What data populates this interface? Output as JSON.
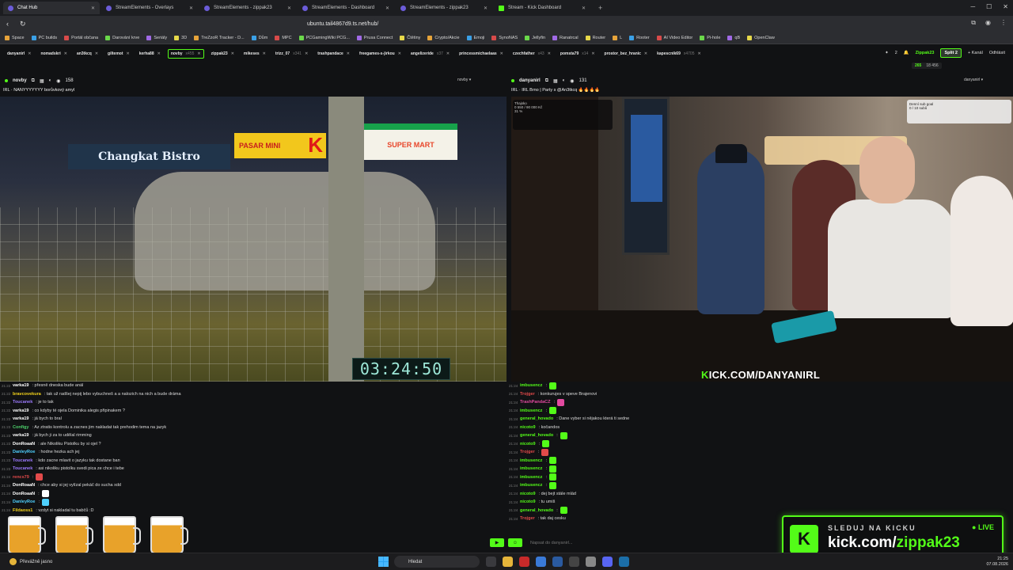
{
  "browser": {
    "tabs": [
      {
        "label": "Chat Hub",
        "active": true
      },
      {
        "label": "StreamElements - Overlays"
      },
      {
        "label": "StreamElements - zippak23"
      },
      {
        "label": "StreamElements - Dashboard"
      },
      {
        "label": "StreamElements - zippak23"
      },
      {
        "label": "Stream - Kick Dashboard",
        "kick": true
      }
    ],
    "url": "ubuntu.tail4867d9.ts.net/hub/"
  },
  "bookmarks": [
    "Space",
    "PC builds",
    "Portál občana",
    "Darování krve",
    "Seriály",
    "3D",
    "TreZzoR Tracker - D...",
    "Dům",
    "MPC",
    "PCGamingWiki PCG...",
    "Prusa Connect",
    "Čtětiny",
    "Crypto/Akcie",
    "Emoji",
    "SynoNAS",
    "Jellyfin",
    "Ranatrcal",
    "Router",
    "L",
    "Rooter",
    "AI Video Editor",
    "Pi-hole",
    "qB",
    "OpenClaw"
  ],
  "channel_tabs": [
    {
      "name": "danyanirl"
    },
    {
      "name": "nomadskri"
    },
    {
      "name": "an3tkcq"
    },
    {
      "name": "giltemot"
    },
    {
      "name": "kerha88"
    },
    {
      "name": "novby",
      "cnt": "x455",
      "selected": true
    },
    {
      "name": "zippak23"
    },
    {
      "name": "mikeses"
    },
    {
      "name": "trizz_07",
      "cnt": "x341"
    },
    {
      "name": "trashpandace"
    },
    {
      "name": "freegames-s-jirkou"
    },
    {
      "name": "angelizeride",
      "cnt": "x37"
    },
    {
      "name": "princessmichaelaas"
    },
    {
      "name": "czechfather",
      "cnt": "x43"
    },
    {
      "name": "pomsta79",
      "cnt": "x14"
    },
    {
      "name": "prostor_bez_hranic"
    },
    {
      "name": "kapescnik69",
      "cnt": "x4705"
    }
  ],
  "toolbar": {
    "count": "2",
    "zippak": "Zippak23",
    "split": "Split 2",
    "kanal": "+ Kanál",
    "odhlasit": "Odhlásit"
  },
  "viewers_bar": {
    "a": "265",
    "b": "18 456"
  },
  "left_panel": {
    "channel": "novby",
    "viewers": "158",
    "selector": "novby",
    "title": "IRL · NANYYYYYYY borůvkový amyl",
    "timer": "03:24:50",
    "signs": {
      "bistro": "Changkat Bistro",
      "pasar": "PASAR MINI",
      "k": "K",
      "supermart": "SUPER MART"
    }
  },
  "right_panel": {
    "channel": "danyanirl",
    "viewers": "131",
    "selector": "danyanirl",
    "title": "IRL · IRL Brno | Party s @An3tkcq 🔥🔥🔥🔥",
    "brand_k": "K",
    "brand_rest": "ICK.COM/DANYANIRL",
    "overlay1": {
      "a": "Thajsko",
      "b": "0 550 / 90 000 Kč",
      "c": "31 %"
    },
    "overlay2": {
      "a": "Denní sub goal",
      "b": "0 / 10 subů"
    }
  },
  "chat_left": [
    {
      "ts": "21:22",
      "user": "varka19",
      "color": "#ffffff",
      "text": ": přesně dneska bude anál"
    },
    {
      "ts": "21:22",
      "user": "bravcovekura",
      "color": "#f2d21b",
      "text": ": tak už radšej nepij lebo vybuchneš a a nalozich na nich a bude dráma"
    },
    {
      "ts": "21:22",
      "user": "Toucanek",
      "color": "#9d7bff",
      "text": ": je to tak"
    },
    {
      "ts": "21:22",
      "user": "varka19",
      "color": "#ffffff",
      "text": ": co kdyby té ojela Dominika alegis připinakem ?"
    },
    {
      "ts": "21:23",
      "user": "varka19",
      "color": "#ffffff",
      "text": ": já bych to bral"
    },
    {
      "ts": "21:23",
      "user": "Configy",
      "color": "#4dd06b",
      "text": ": Az ztratis kontrolu a zacnes jim nakladat tak prehodim tema na jazyk"
    },
    {
      "ts": "21:23",
      "user": "varka19",
      "color": "#ffffff",
      "text": ": já bych ji za to udělal rimming"
    },
    {
      "ts": "21:23",
      "user": "DonRoaaN",
      "color": "#ffffff",
      "text": ": ale Nikoliku Pistolku by si ojel ?"
    },
    {
      "ts": "21:23",
      "user": "DanleyRoe",
      "color": "#4fd1ff",
      "text": ": hodne hezka ach jej"
    },
    {
      "ts": "21:23",
      "user": "Toucanek",
      "color": "#9d7bff",
      "text": ": kdo zacne mlavit o jazyku tak dostane ban"
    },
    {
      "ts": "21:23",
      "user": "Toucanek",
      "color": "#9d7bff",
      "text": ": asi nikoliku pistolku svedi pica ze chce i tebe"
    },
    {
      "ts": "21:24",
      "user": "rencs79",
      "color": "#e24a4a",
      "text": ":"
    },
    {
      "ts": "21:24",
      "user": "DonRoaaN",
      "color": "#ffffff",
      "text": ": chce aby si jej vylízal pekáč do sucha xdd"
    },
    {
      "ts": "21:24",
      "user": "DonRoaaN",
      "color": "#ffffff",
      "text": ":"
    },
    {
      "ts": "21:24",
      "user": "DanleyRoe",
      "color": "#4fd1ff",
      "text": ":"
    },
    {
      "ts": "21:24",
      "user": "Fildaoss1",
      "color": "#f2d21b",
      "text": ": vzdyt si nakladal tu babčů :D"
    }
  ],
  "chat_right": [
    {
      "ts": "21:24",
      "user": "imbusencz",
      "color": "#53fc18",
      "text": ":"
    },
    {
      "ts": "21:24",
      "user": "Trojger",
      "color": "#e24a4a",
      "text": ": konkurujes v speve Brajenovi"
    },
    {
      "ts": "21:24",
      "user": "TrashPandaCZ",
      "color": "#e24aa0",
      "text": ":"
    },
    {
      "ts": "21:24",
      "user": "imbusencz",
      "color": "#53fc18",
      "text": ":"
    },
    {
      "ts": "21:24",
      "user": "general_hovado",
      "color": "#53fc18",
      "text": ": Dane vyber si nějakou která ti sedne"
    },
    {
      "ts": "21:24",
      "user": "nicoto9",
      "color": "#53fc18",
      "text": ": kočandos"
    },
    {
      "ts": "21:24",
      "user": "general_hovado",
      "color": "#53fc18",
      "text": ":"
    },
    {
      "ts": "21:24",
      "user": "nicoto9",
      "color": "#53fc18",
      "text": ":"
    },
    {
      "ts": "21:24",
      "user": "Trojger",
      "color": "#e24a4a",
      "text": ":"
    },
    {
      "ts": "21:24",
      "user": "imbusencz",
      "color": "#53fc18",
      "text": ":"
    },
    {
      "ts": "21:24",
      "user": "imbusencz",
      "color": "#53fc18",
      "text": ":"
    },
    {
      "ts": "21:24",
      "user": "imbusencz",
      "color": "#53fc18",
      "text": ":"
    },
    {
      "ts": "21:24",
      "user": "imbusencz",
      "color": "#53fc18",
      "text": ":"
    },
    {
      "ts": "21:24",
      "user": "nicoto9",
      "color": "#53fc18",
      "text": ": dej bejt stále mlád"
    },
    {
      "ts": "21:24",
      "user": "nicoto9",
      "color": "#53fc18",
      "text": ": tu umiš"
    },
    {
      "ts": "21:24",
      "user": "general_hovado",
      "color": "#53fc18",
      "text": ":"
    },
    {
      "ts": "21:24",
      "user": "Trojger",
      "color": "#e24a4a",
      "text": ": tak daj cesku"
    }
  ],
  "chat_input": {
    "placeholder": "Napsat do danyanirl..."
  },
  "kick_promo": {
    "line1": "SLEDUJ NA KICKU",
    "live": "● LIVE",
    "domain": "kick.com/",
    "channel": "zippak23",
    "logo": "K"
  },
  "taskbar": {
    "weather": "Převážně jasno",
    "search": "Hledat",
    "time": "21:25",
    "date": "07.08.2026"
  },
  "colors": {
    "accent": "#53fc18"
  }
}
